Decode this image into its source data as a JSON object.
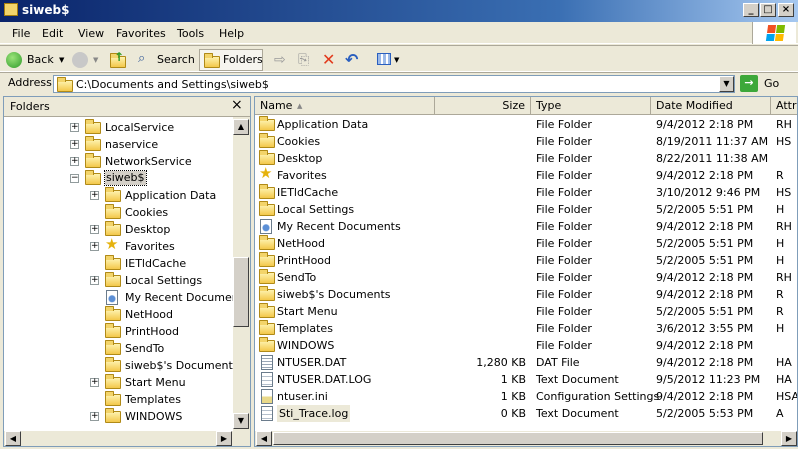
{
  "window": {
    "title": "siweb$"
  },
  "menu": [
    "File",
    "Edit",
    "View",
    "Favorites",
    "Tools",
    "Help"
  ],
  "toolbar": {
    "back": "Back",
    "search": "Search",
    "folders": "Folders"
  },
  "address": {
    "label": "Address",
    "value": "C:\\Documents and Settings\\siweb$",
    "go": "Go"
  },
  "folders_pane": {
    "title": "Folders",
    "close": "×",
    "tree": [
      {
        "label": "LocalService",
        "expander": "+",
        "icon": "folder"
      },
      {
        "label": "naservice",
        "expander": "+",
        "icon": "folder"
      },
      {
        "label": "NetworkService",
        "expander": "+",
        "icon": "folder"
      },
      {
        "label": "siweb$",
        "expander": "-",
        "icon": "folder-open"
      },
      {
        "label": "Application Data",
        "expander": "+",
        "icon": "folder"
      },
      {
        "label": "Cookies",
        "expander": "",
        "icon": "folder"
      },
      {
        "label": "Desktop",
        "expander": "+",
        "icon": "folder"
      },
      {
        "label": "Favorites",
        "expander": "+",
        "icon": "star-icon"
      },
      {
        "label": "IETldCache",
        "expander": "",
        "icon": "folder"
      },
      {
        "label": "Local Settings",
        "expander": "+",
        "icon": "folder"
      },
      {
        "label": "My Recent Documents",
        "expander": "",
        "icon": "recent-docs-icon"
      },
      {
        "label": "NetHood",
        "expander": "",
        "icon": "folder"
      },
      {
        "label": "PrintHood",
        "expander": "",
        "icon": "folder"
      },
      {
        "label": "SendTo",
        "expander": "",
        "icon": "folder"
      },
      {
        "label": "siweb$'s Documents",
        "expander": "",
        "icon": "folder"
      },
      {
        "label": "Start Menu",
        "expander": "+",
        "icon": "folder"
      },
      {
        "label": "Templates",
        "expander": "",
        "icon": "folder"
      },
      {
        "label": "WINDOWS",
        "expander": "+",
        "icon": "folder"
      }
    ]
  },
  "columns": {
    "name": "Name",
    "size": "Size",
    "type": "Type",
    "date": "Date Modified",
    "attr": "Attri"
  },
  "files": [
    {
      "name": "Application Data",
      "size": "",
      "type": "File Folder",
      "date": "9/4/2012 2:18 PM",
      "attr": "RH",
      "icon": "folder"
    },
    {
      "name": "Cookies",
      "size": "",
      "type": "File Folder",
      "date": "8/19/2011 11:37 AM",
      "attr": "HS",
      "icon": "folder"
    },
    {
      "name": "Desktop",
      "size": "",
      "type": "File Folder",
      "date": "8/22/2011 11:38 AM",
      "attr": "",
      "icon": "folder"
    },
    {
      "name": "Favorites",
      "size": "",
      "type": "File Folder",
      "date": "9/4/2012 2:18 PM",
      "attr": "R",
      "icon": "star-icon"
    },
    {
      "name": "IETldCache",
      "size": "",
      "type": "File Folder",
      "date": "3/10/2012 9:46 PM",
      "attr": "HS",
      "icon": "folder"
    },
    {
      "name": "Local Settings",
      "size": "",
      "type": "File Folder",
      "date": "5/2/2005 5:51 PM",
      "attr": "H",
      "icon": "folder"
    },
    {
      "name": "My Recent Documents",
      "size": "",
      "type": "File Folder",
      "date": "9/4/2012 2:18 PM",
      "attr": "RH",
      "icon": "recent-docs-icon"
    },
    {
      "name": "NetHood",
      "size": "",
      "type": "File Folder",
      "date": "5/2/2005 5:51 PM",
      "attr": "H",
      "icon": "folder"
    },
    {
      "name": "PrintHood",
      "size": "",
      "type": "File Folder",
      "date": "5/2/2005 5:51 PM",
      "attr": "H",
      "icon": "folder"
    },
    {
      "name": "SendTo",
      "size": "",
      "type": "File Folder",
      "date": "9/4/2012 2:18 PM",
      "attr": "RH",
      "icon": "folder"
    },
    {
      "name": "siweb$'s Documents",
      "size": "",
      "type": "File Folder",
      "date": "9/4/2012 2:18 PM",
      "attr": "R",
      "icon": "folder"
    },
    {
      "name": "Start Menu",
      "size": "",
      "type": "File Folder",
      "date": "5/2/2005 5:51 PM",
      "attr": "R",
      "icon": "folder"
    },
    {
      "name": "Templates",
      "size": "",
      "type": "File Folder",
      "date": "3/6/2012 3:55 PM",
      "attr": "H",
      "icon": "folder"
    },
    {
      "name": "WINDOWS",
      "size": "",
      "type": "File Folder",
      "date": "9/4/2012 2:18 PM",
      "attr": "",
      "icon": "folder"
    },
    {
      "name": "NTUSER.DAT",
      "size": "1,280 KB",
      "type": "DAT File",
      "date": "9/4/2012 2:18 PM",
      "attr": "HA",
      "icon": "dat-file-icon"
    },
    {
      "name": "NTUSER.DAT.LOG",
      "size": "1 KB",
      "type": "Text Document",
      "date": "9/5/2012 11:23 PM",
      "attr": "HA",
      "icon": "text-file-icon"
    },
    {
      "name": "ntuser.ini",
      "size": "1 KB",
      "type": "Configuration Settings",
      "date": "9/4/2012 2:18 PM",
      "attr": "HSA",
      "icon": "ini-file-icon"
    },
    {
      "name": "Sti_Trace.log",
      "size": "0 KB",
      "type": "Text Document",
      "date": "5/2/2005 5:53 PM",
      "attr": "A",
      "icon": "text-file-icon"
    }
  ]
}
